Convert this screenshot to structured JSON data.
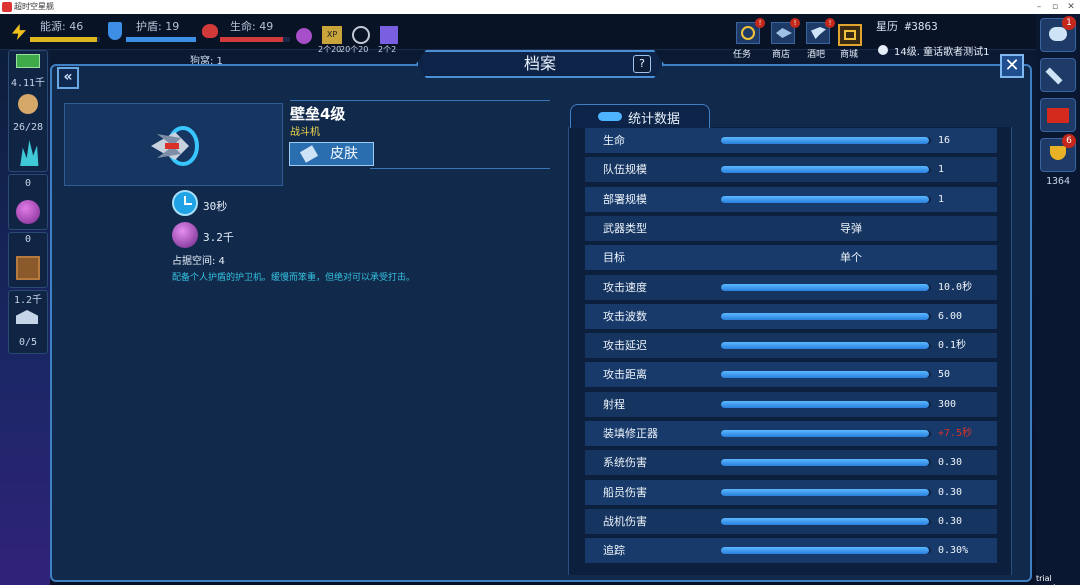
{
  "window": {
    "title": "超时空星舰"
  },
  "hud": {
    "energy_label": "能源: 46",
    "shield_label": "护盾: 19",
    "life_label": "生命: 49",
    "tokens": [
      "2个20",
      "20个20",
      "2个2"
    ],
    "cabin_label": "狗窝: 1",
    "icons": [
      "lightning-icon",
      "shield-icon",
      "heart-icon",
      "orb-icon",
      "xp-icon",
      "crosshair-icon",
      "map-icon"
    ],
    "top_buttons": [
      {
        "label": "任务",
        "icon": "mission-icon",
        "alert": true
      },
      {
        "label": "商店",
        "icon": "ship-icon",
        "alert": true
      },
      {
        "label": "酒吧",
        "icon": "bird-icon",
        "alert": true
      },
      {
        "label": "商城",
        "icon": "store-icon",
        "alert": false
      }
    ],
    "stardate": "星历 #3863",
    "story_hint": "14级. 童话歌者测试1"
  },
  "left_resources": [
    {
      "value": "4.11千",
      "icon": "cash-icon"
    },
    {
      "value": "26/28",
      "icon": "crew-icon"
    },
    {
      "value": "0",
      "icon": "crystal-icon"
    },
    {
      "value": "0",
      "icon": "plasma-orb-icon"
    },
    {
      "value": "1.2千",
      "icon": "crate-icon"
    },
    {
      "value": "0/5",
      "icon": "hangar-icon"
    }
  ],
  "right_sidebar": {
    "chat_badge": "1",
    "trophy_badge": "6",
    "trophy_count": "1364"
  },
  "panel": {
    "title": "档案",
    "help_label": "?",
    "close_label": "✕",
    "back_label": "«"
  },
  "unit": {
    "name": "壁垒4级",
    "type": "战斗机",
    "skin_label": "皮肤",
    "build_time": "30秒",
    "cost": "3.2千",
    "occupancy": "占据空间: 4",
    "description": "配备个人护盾的护卫机。缓慢而笨重，但绝对可以承受打击。"
  },
  "stats": {
    "header": "统计数据",
    "rows": [
      {
        "label": "生命",
        "value": "16",
        "fill": 0.99,
        "kind": "bar"
      },
      {
        "label": "队伍规模",
        "value": "1",
        "fill": 0.99,
        "kind": "bar"
      },
      {
        "label": "部署规模",
        "value": "1",
        "fill": 0.99,
        "kind": "bar"
      },
      {
        "label": "武器类型",
        "value": "导弹",
        "kind": "center"
      },
      {
        "label": "目标",
        "value": "单个",
        "kind": "center"
      },
      {
        "label": "攻击速度",
        "value": "10.0秒",
        "fill": 0.99,
        "kind": "bar"
      },
      {
        "label": "攻击波数",
        "value": "6.00",
        "fill": 0.99,
        "kind": "bar"
      },
      {
        "label": "攻击延迟",
        "value": "0.1秒",
        "fill": 0.99,
        "kind": "bar"
      },
      {
        "label": "攻击距离",
        "value": "50",
        "fill": 0.99,
        "kind": "bar"
      },
      {
        "label": "射程",
        "value": "300",
        "fill": 0.99,
        "kind": "bar"
      },
      {
        "label": "装填修正器",
        "value": "+7.5秒",
        "fill": 0.99,
        "kind": "bar",
        "color": "#d9302a"
      },
      {
        "label": "系统伤害",
        "value": "0.30",
        "fill": 0.99,
        "kind": "bar"
      },
      {
        "label": "船员伤害",
        "value": "0.30",
        "fill": 0.99,
        "kind": "bar"
      },
      {
        "label": "战机伤害",
        "value": "0.30",
        "fill": 0.99,
        "kind": "bar"
      },
      {
        "label": "追踪",
        "value": "0.30%",
        "fill": 0.99,
        "kind": "bar"
      }
    ]
  },
  "watermark": "trial version",
  "colors": {
    "accent": "#3f7fc4",
    "warning": "#d9302a",
    "type_yellow": "#f0d84c",
    "desc_cyan": "#35c1e0"
  }
}
